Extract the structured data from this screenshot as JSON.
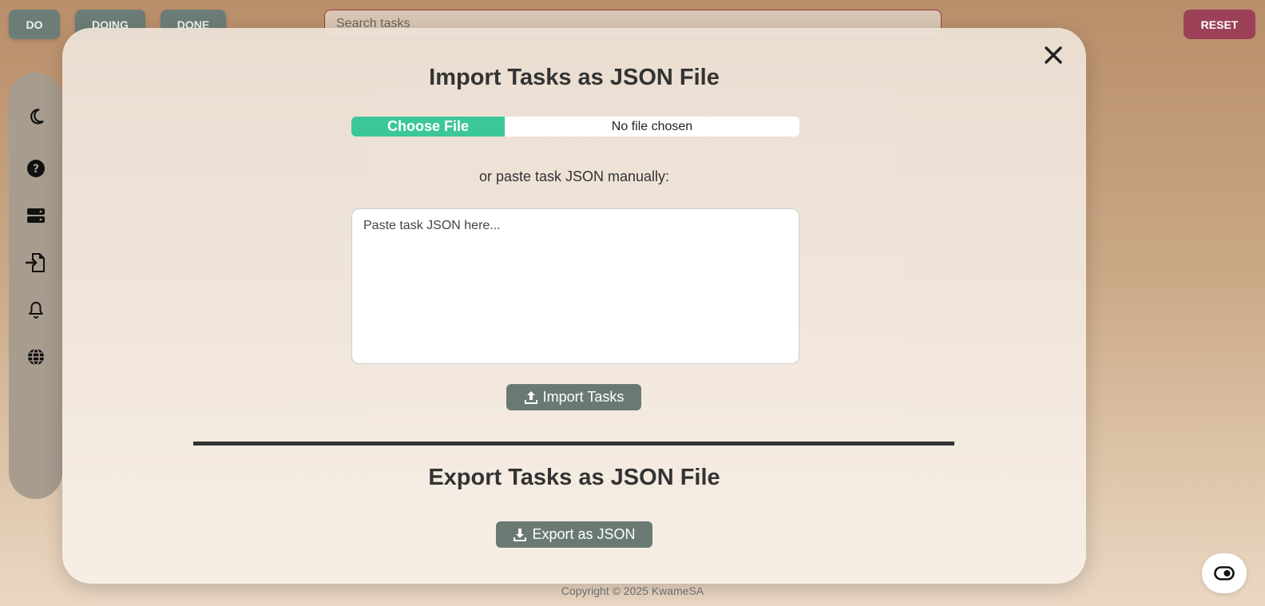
{
  "topbar": {
    "do_label": "DO",
    "doing_label": "DOING",
    "done_label": "DONE",
    "reset_label": "RESET",
    "search_placeholder": "Search tasks"
  },
  "sidebar": {
    "items": [
      {
        "icon": "moon-icon"
      },
      {
        "icon": "help-icon"
      },
      {
        "icon": "storage-icon"
      },
      {
        "icon": "file-import-icon"
      },
      {
        "icon": "bell-icon"
      },
      {
        "icon": "globe-icon"
      }
    ]
  },
  "modal": {
    "import_title": "Import Tasks as JSON File",
    "file_button_label": "Choose File",
    "file_status": "No file chosen",
    "paste_label": "or paste task JSON manually:",
    "textarea_placeholder": "Paste task JSON here...",
    "import_button_label": "Import Tasks",
    "export_title": "Export Tasks as JSON File",
    "export_button_label": "Export as JSON",
    "close_icon": "close-icon"
  },
  "footer": {
    "copyright": "Copyright © 2025 KwameSA"
  },
  "colors": {
    "accent_green": "#3cc79a",
    "button_gray": "#6a7a73",
    "reset_red": "#9c4158"
  }
}
